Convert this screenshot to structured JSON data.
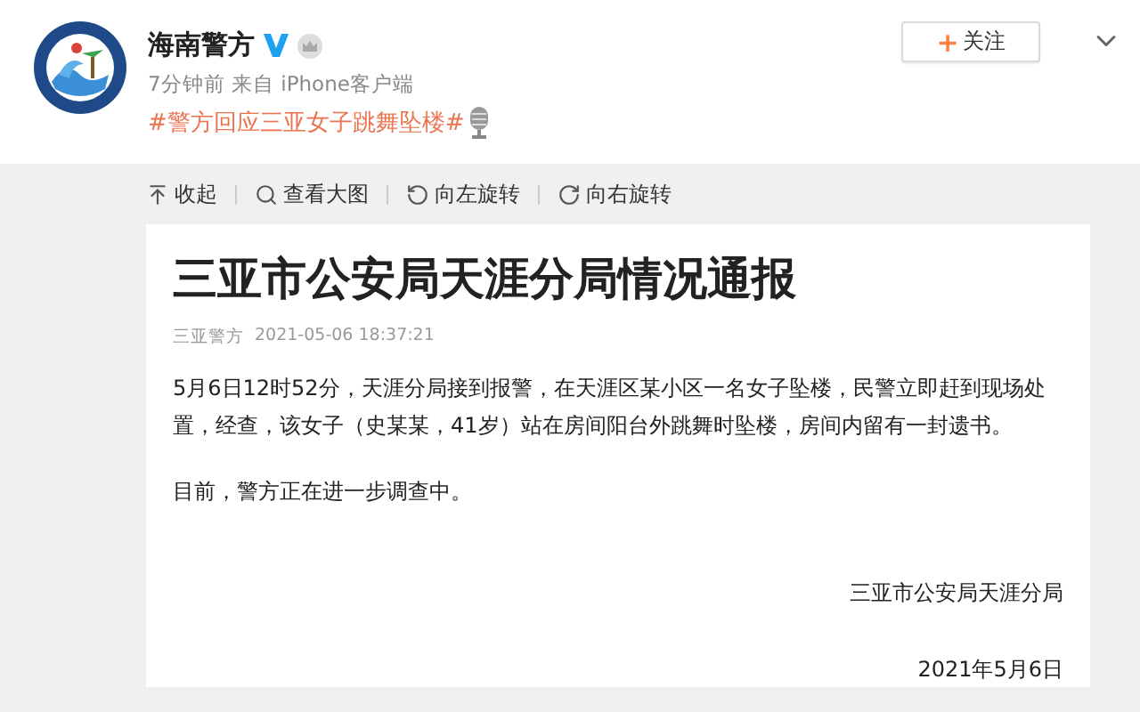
{
  "post": {
    "author": "海南警方",
    "meta": "7分钟前 来自 iPhone客户端",
    "hashtag": "#警方回应三亚女子跳舞坠楼#",
    "follow_button": {
      "icon": "+",
      "label": "关注"
    }
  },
  "toolbar": [
    {
      "kind": "collapse",
      "label": "收起"
    },
    {
      "kind": "zoom",
      "label": "查看大图"
    },
    {
      "kind": "rotate_left",
      "label": "向左旋转"
    },
    {
      "kind": "rotate_right",
      "label": "向右旋转"
    }
  ],
  "document": {
    "title": "三亚市公安局天涯分局情况通报",
    "source": "三亚警方",
    "timestamp": "2021-05-06 18:37:21",
    "paragraphs": [
      "5月6日12时52分，天涯分局接到报警，在天涯区某小区一名女子坠楼，民警立即赶到现场处置，经查，该女子（史某某，41岁）站在房间阳台外跳舞时坠楼，房间内留有一封遗书。",
      "目前，警方正在进一步调查中。"
    ],
    "signature": "三亚市公安局天涯分局",
    "date": "2021年5月6日"
  }
}
